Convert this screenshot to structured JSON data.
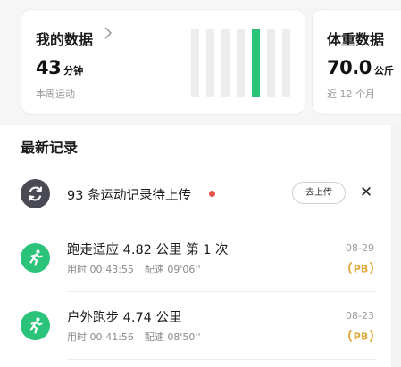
{
  "summary_cards": {
    "my_data": {
      "title": "我的数据",
      "chevron": "chevron-right-icon",
      "value": "43",
      "unit": "分钟",
      "caption": "本周运动",
      "weekly_bars": {
        "count": 7,
        "active_index": 4,
        "active_color": "#2bc27a",
        "inactive_color": "#ededed"
      }
    },
    "weight": {
      "title": "体重数据",
      "value": "70.0",
      "unit": "公斤",
      "caption": "近 12 个月"
    }
  },
  "latest": {
    "section_title": "最新记录",
    "pending_upload": {
      "icon": "sync-icon",
      "text": "93 条运动记录待上传",
      "dot_color": "#e8504a",
      "upload_button": "去上传",
      "close_icon": "close-icon",
      "close_glyph": "✕"
    },
    "records": [
      {
        "icon": "running-icon",
        "title": "跑走适应  4.82 公里  第 1 次",
        "duration_label": "用时 00:43:55",
        "pace_label": "配速 09'06''",
        "date": "08-29",
        "badge": "PB"
      },
      {
        "icon": "running-icon",
        "title": "户外跑步  4.74 公里",
        "duration_label": "用时 00:41:56",
        "pace_label": "配速 08'50''",
        "date": "08-23",
        "badge": "PB"
      }
    ]
  },
  "colors": {
    "accent_green": "#2bc27a",
    "badge_gold": "#e0a93a",
    "sync_icon_bg": "#4a4a54"
  }
}
